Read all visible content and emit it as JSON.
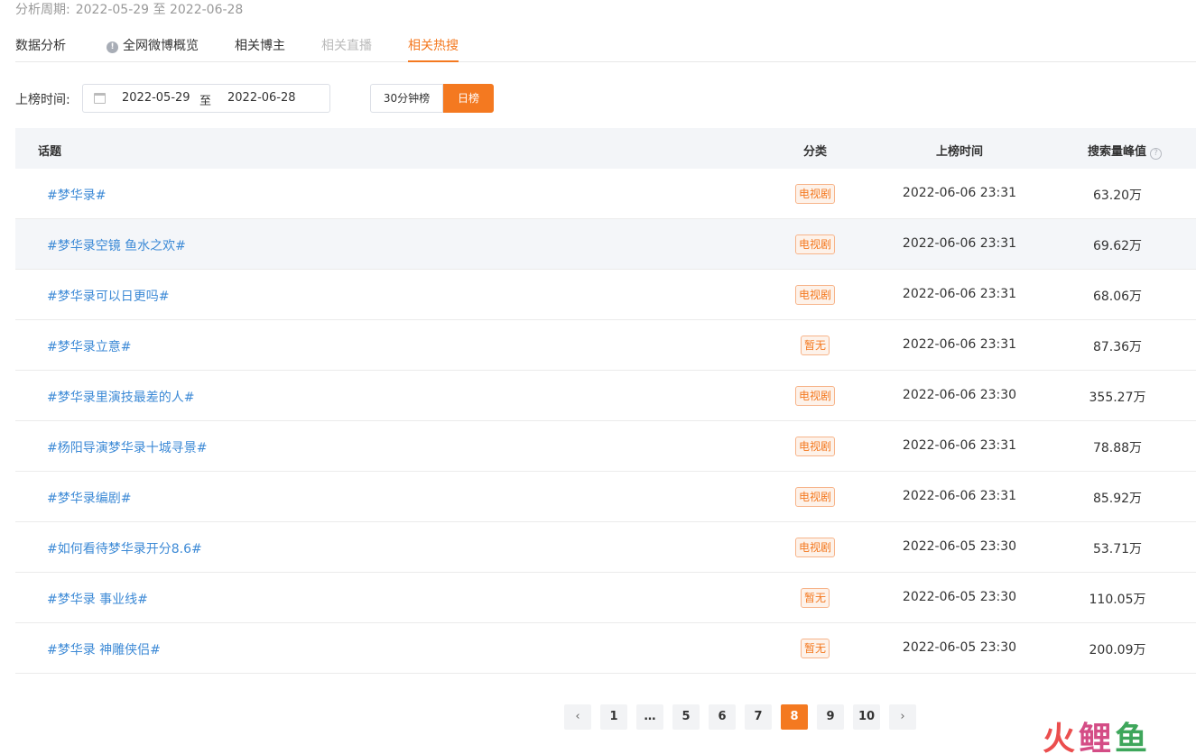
{
  "period": {
    "label": "分析周期:",
    "value": "2022-05-29 至 2022-06-28"
  },
  "tabs": [
    {
      "label": "数据分析",
      "state": "normal"
    },
    {
      "label": "全网微博概览",
      "state": "normal",
      "icon": "info-icon"
    },
    {
      "label": "相关博主",
      "state": "normal"
    },
    {
      "label": "相关直播",
      "state": "disabled"
    },
    {
      "label": "相关热搜",
      "state": "active"
    }
  ],
  "filter": {
    "label": "上榜时间:",
    "start": "2022-05-29",
    "separator": "至",
    "end": "2022-06-28",
    "seg_30min": "30分钟榜",
    "seg_daily": "日榜"
  },
  "table": {
    "headers": {
      "topic": "话题",
      "category": "分类",
      "time": "上榜时间",
      "peak": "搜索量峰值"
    },
    "rows": [
      {
        "topic": "#梦华录#",
        "category": "电视剧",
        "time": "2022-06-06 23:31",
        "peak": "63.20万"
      },
      {
        "topic": "#梦华录空镜 鱼水之欢#",
        "category": "电视剧",
        "time": "2022-06-06 23:31",
        "peak": "69.62万"
      },
      {
        "topic": "#梦华录可以日更吗#",
        "category": "电视剧",
        "time": "2022-06-06 23:31",
        "peak": "68.06万"
      },
      {
        "topic": "#梦华录立意#",
        "category": "暂无",
        "time": "2022-06-06 23:31",
        "peak": "87.36万"
      },
      {
        "topic": "#梦华录里演技最差的人#",
        "category": "电视剧",
        "time": "2022-06-06 23:30",
        "peak": "355.27万"
      },
      {
        "topic": "#杨阳导演梦华录十城寻景#",
        "category": "电视剧",
        "time": "2022-06-06 23:31",
        "peak": "78.88万"
      },
      {
        "topic": "#梦华录编剧#",
        "category": "电视剧",
        "time": "2022-06-06 23:31",
        "peak": "85.92万"
      },
      {
        "topic": "#如何看待梦华录开分8.6#",
        "category": "电视剧",
        "time": "2022-06-05 23:30",
        "peak": "53.71万"
      },
      {
        "topic": "#梦华录 事业线#",
        "category": "暂无",
        "time": "2022-06-05 23:30",
        "peak": "110.05万"
      },
      {
        "topic": "#梦华录 神雕侠侣#",
        "category": "暂无",
        "time": "2022-06-05 23:30",
        "peak": "200.09万"
      }
    ]
  },
  "pagination": {
    "prev": "‹",
    "pages": [
      "1",
      "…",
      "5",
      "6",
      "7",
      "8",
      "9",
      "10"
    ],
    "current": "8",
    "next": "›"
  },
  "watermark": {
    "c1": "火",
    "c2": "鲤",
    "c3": "鱼"
  },
  "colors": {
    "accent": "#f47920",
    "link": "#3d8ad6"
  }
}
